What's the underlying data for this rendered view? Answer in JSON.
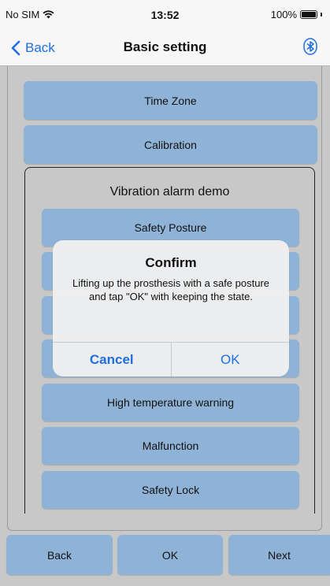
{
  "status_bar": {
    "carrier": "No SIM",
    "time": "13:52",
    "battery": "100%"
  },
  "nav": {
    "back_label": "Back",
    "title": "Basic setting",
    "bluetooth_icon": "bluetooth-icon"
  },
  "settings": {
    "time_zone": "Time Zone",
    "calibration": "Calibration"
  },
  "demo": {
    "title": "Vibration alarm demo",
    "items": [
      "Safety Posture",
      "High temperature warning",
      "Malfunction",
      "Safety Lock"
    ]
  },
  "dialog": {
    "title": "Confirm",
    "message": "Lifting up the prosthesis with a safe posture and tap \"OK\" with keeping the state.",
    "cancel": "Cancel",
    "ok": "OK"
  },
  "footer": {
    "back": "Back",
    "ok": "OK",
    "next": "Next"
  },
  "colors": {
    "accent": "#1f6fe0",
    "button": "#8fb3d6",
    "background": "#c8c8c8"
  }
}
